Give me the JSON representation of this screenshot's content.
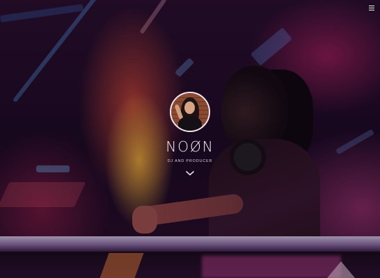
{
  "profile": {
    "name": "NOØN",
    "tagline": "DJ and Producer"
  },
  "icons": {
    "menu": "menu-icon",
    "scroll": "chevron-down-icon"
  },
  "colors": {
    "text": "#f4eef4",
    "accent_glow": "#e0508c"
  }
}
